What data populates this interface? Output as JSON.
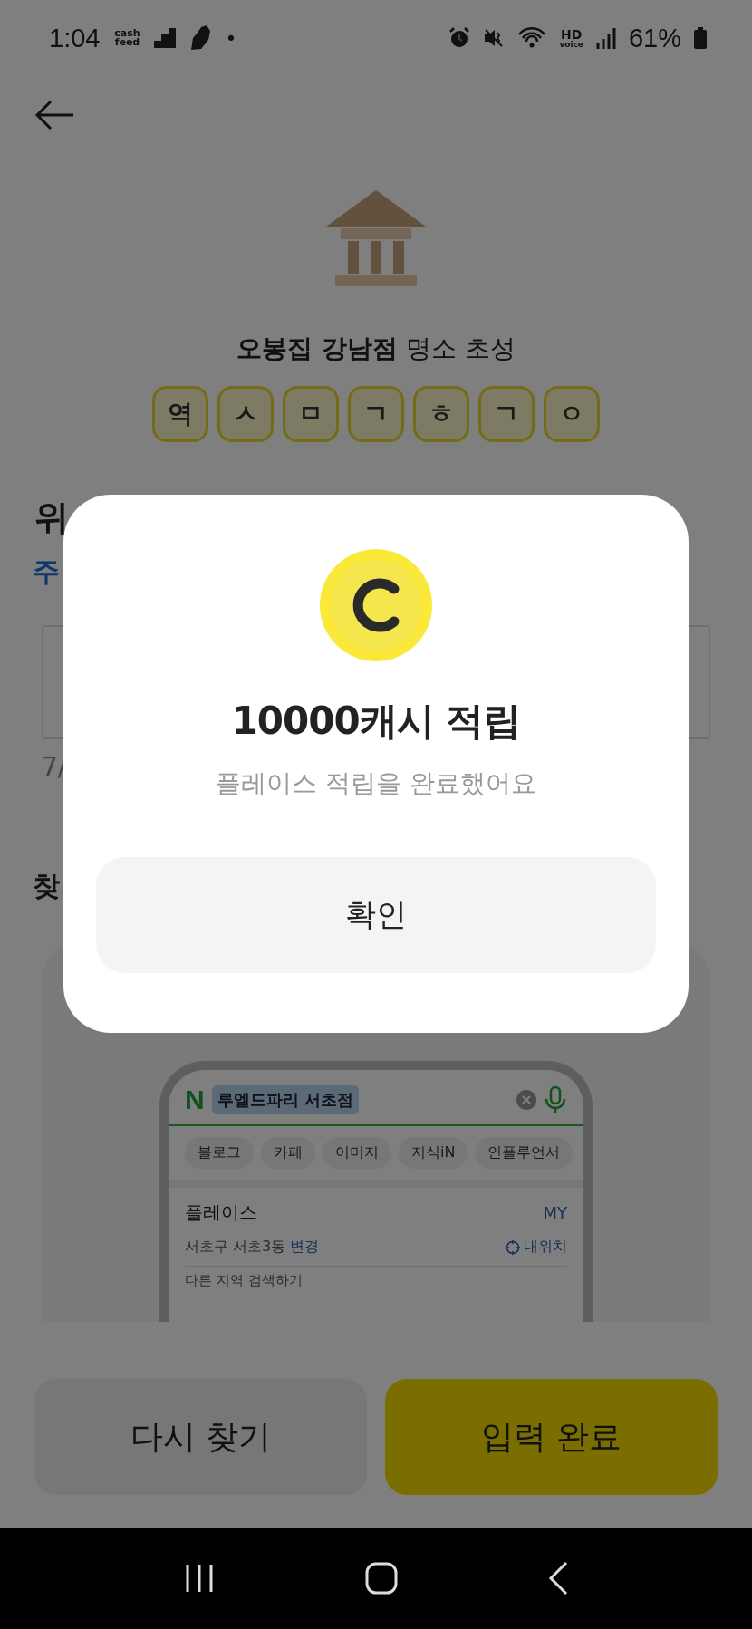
{
  "status_bar": {
    "time": "1:04",
    "app_logo": "cash feed",
    "dot": "•",
    "hd": "HD",
    "voice": "voice",
    "battery": "61%"
  },
  "place": {
    "name": "오봉집 강남점",
    "suffix": "명소 초성"
  },
  "hint_letters": [
    "역",
    "ㅅ",
    "ㅁ",
    "ㄱ",
    "ㅎ",
    "ㄱ",
    "ㅇ"
  ],
  "question": {
    "heading": "위",
    "link": "주"
  },
  "answer_field": {
    "counter": "7/"
  },
  "section_title": "찾",
  "example": {
    "logo": "N",
    "query": "루엘드파리 서초점",
    "chips": [
      "블로그",
      "카페",
      "이미지",
      "지식iN",
      "인플루언서"
    ],
    "place_title": "플레이스",
    "my": "MY",
    "location": "서초구 서초3동",
    "change": "변경",
    "my_location": "내위치",
    "other_region": "다른 지역 검색하기"
  },
  "buttons": [
    {
      "label": "다시 찾기",
      "kind": "secondary"
    },
    {
      "label": "입력 완료",
      "kind": "primary"
    }
  ],
  "dialog": {
    "title": "10000캐시 적립",
    "message": "플레이스 적립을 완료했어요",
    "confirm": "확인"
  }
}
